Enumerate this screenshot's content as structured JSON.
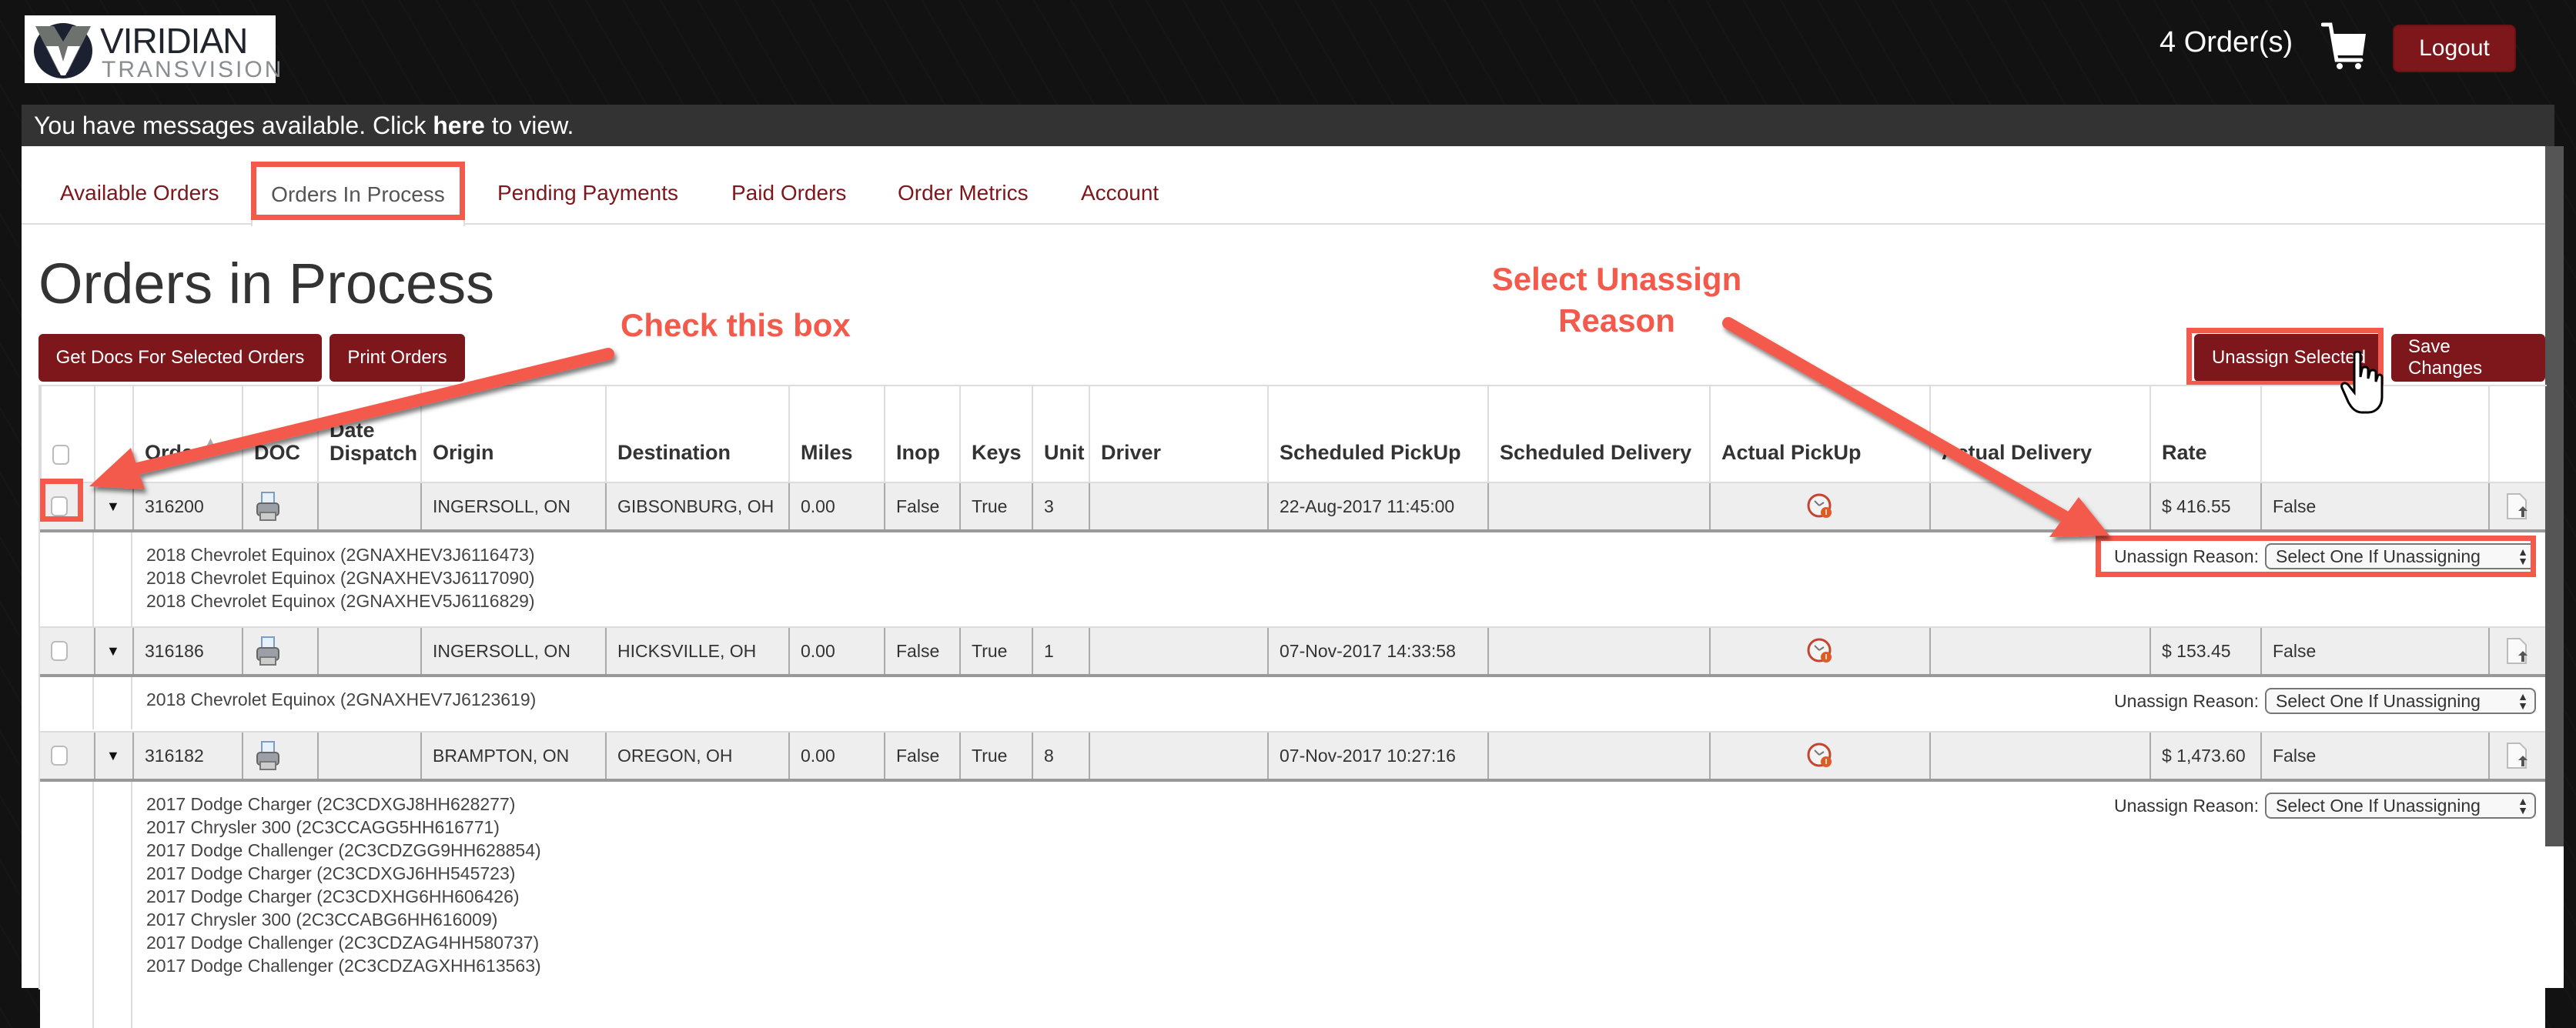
{
  "header": {
    "logo_top": "VIRIDIAN",
    "logo_bottom": "TRANSVISION",
    "orders_count": "4 Order(s)",
    "cart_icon": "shopping-cart-icon",
    "logout_label": "Logout"
  },
  "message_bar": {
    "prefix": "You have messages available. Click ",
    "link": "here",
    "suffix": " to view."
  },
  "tabs": [
    {
      "label": "Available Orders",
      "active": false
    },
    {
      "label": "Orders In Process",
      "active": true
    },
    {
      "label": "Pending Payments",
      "active": false
    },
    {
      "label": "Paid Orders",
      "active": false
    },
    {
      "label": "Order Metrics",
      "active": false
    },
    {
      "label": "Account",
      "active": false
    }
  ],
  "page": {
    "title": "Orders in Process",
    "buttons": {
      "get_docs": "Get Docs For Selected Orders",
      "print_orders": "Print Orders",
      "unassign_selected": "Unassign Selected",
      "save_changes": "Save Changes"
    }
  },
  "annotations": {
    "check_box": "Check this box",
    "select_reason_line1": "Select Unassign",
    "select_reason_line2": "Reason"
  },
  "table": {
    "columns": [
      "",
      "",
      "Order",
      "DOC",
      "Date Dispatch",
      "Origin",
      "Destination",
      "Miles",
      "Inop",
      "Keys",
      "Unit",
      "Driver",
      "Scheduled PickUp",
      "Scheduled Delivery",
      "Actual PickUp",
      "Actual Delivery",
      "Rate",
      "",
      ""
    ],
    "unassign_label": "Unassign Reason:",
    "unassign_placeholder": "Select One If Unassigning",
    "orders": [
      {
        "order": "316200",
        "date_dispatch": "",
        "origin": "INGERSOLL, ON",
        "destination": "GIBSONBURG, OH",
        "miles": "0.00",
        "inop": "False",
        "keys": "True",
        "units": "3",
        "driver": "",
        "scheduled_pickup": "22-Aug-2017 11:45:00",
        "scheduled_delivery": "",
        "actual_delivery": "",
        "rate": "$ 416.55",
        "flag": "False",
        "vehicles": [
          "2018 Chevrolet Equinox (2GNAXHEV3J6116473)",
          "2018 Chevrolet Equinox (2GNAXHEV3J6117090)",
          "2018 Chevrolet Equinox (2GNAXHEV5J6116829)"
        ]
      },
      {
        "order": "316186",
        "date_dispatch": "",
        "origin": "INGERSOLL, ON",
        "destination": "HICKSVILLE, OH",
        "miles": "0.00",
        "inop": "False",
        "keys": "True",
        "units": "1",
        "driver": "",
        "scheduled_pickup": "07-Nov-2017 14:33:58",
        "scheduled_delivery": "",
        "actual_delivery": "",
        "rate": "$ 153.45",
        "flag": "False",
        "vehicles": [
          "2018 Chevrolet Equinox (2GNAXHEV7J6123619)"
        ]
      },
      {
        "order": "316182",
        "date_dispatch": "",
        "origin": "BRAMPTON, ON",
        "destination": "OREGON, OH",
        "miles": "0.00",
        "inop": "False",
        "keys": "True",
        "units": "8",
        "driver": "",
        "scheduled_pickup": "07-Nov-2017 10:27:16",
        "scheduled_delivery": "",
        "actual_delivery": "",
        "rate": "$ 1,473.60",
        "flag": "False",
        "vehicles": [
          "2017 Dodge Charger (2C3CDXGJ8HH628277)",
          "2017 Chrysler 300 (2C3CCAGG5HH616771)",
          "2017 Dodge Challenger (2C3CDZGG9HH628854)",
          "2017 Dodge Charger (2C3CDXGJ6HH545723)",
          "2017 Dodge Charger (2C3CDXHG6HH606426)",
          "2017 Chrysler 300 (2C3CCABG6HH616009)",
          "2017 Dodge Challenger (2C3CDZAG4HH580737)",
          "2017 Dodge Challenger (2C3CDZAGXHH613563)"
        ]
      }
    ]
  },
  "colors": {
    "brand": "#7d171c",
    "annotation": "#f45a4b",
    "header_bg": "#141414",
    "message_bar_bg": "#333333"
  }
}
